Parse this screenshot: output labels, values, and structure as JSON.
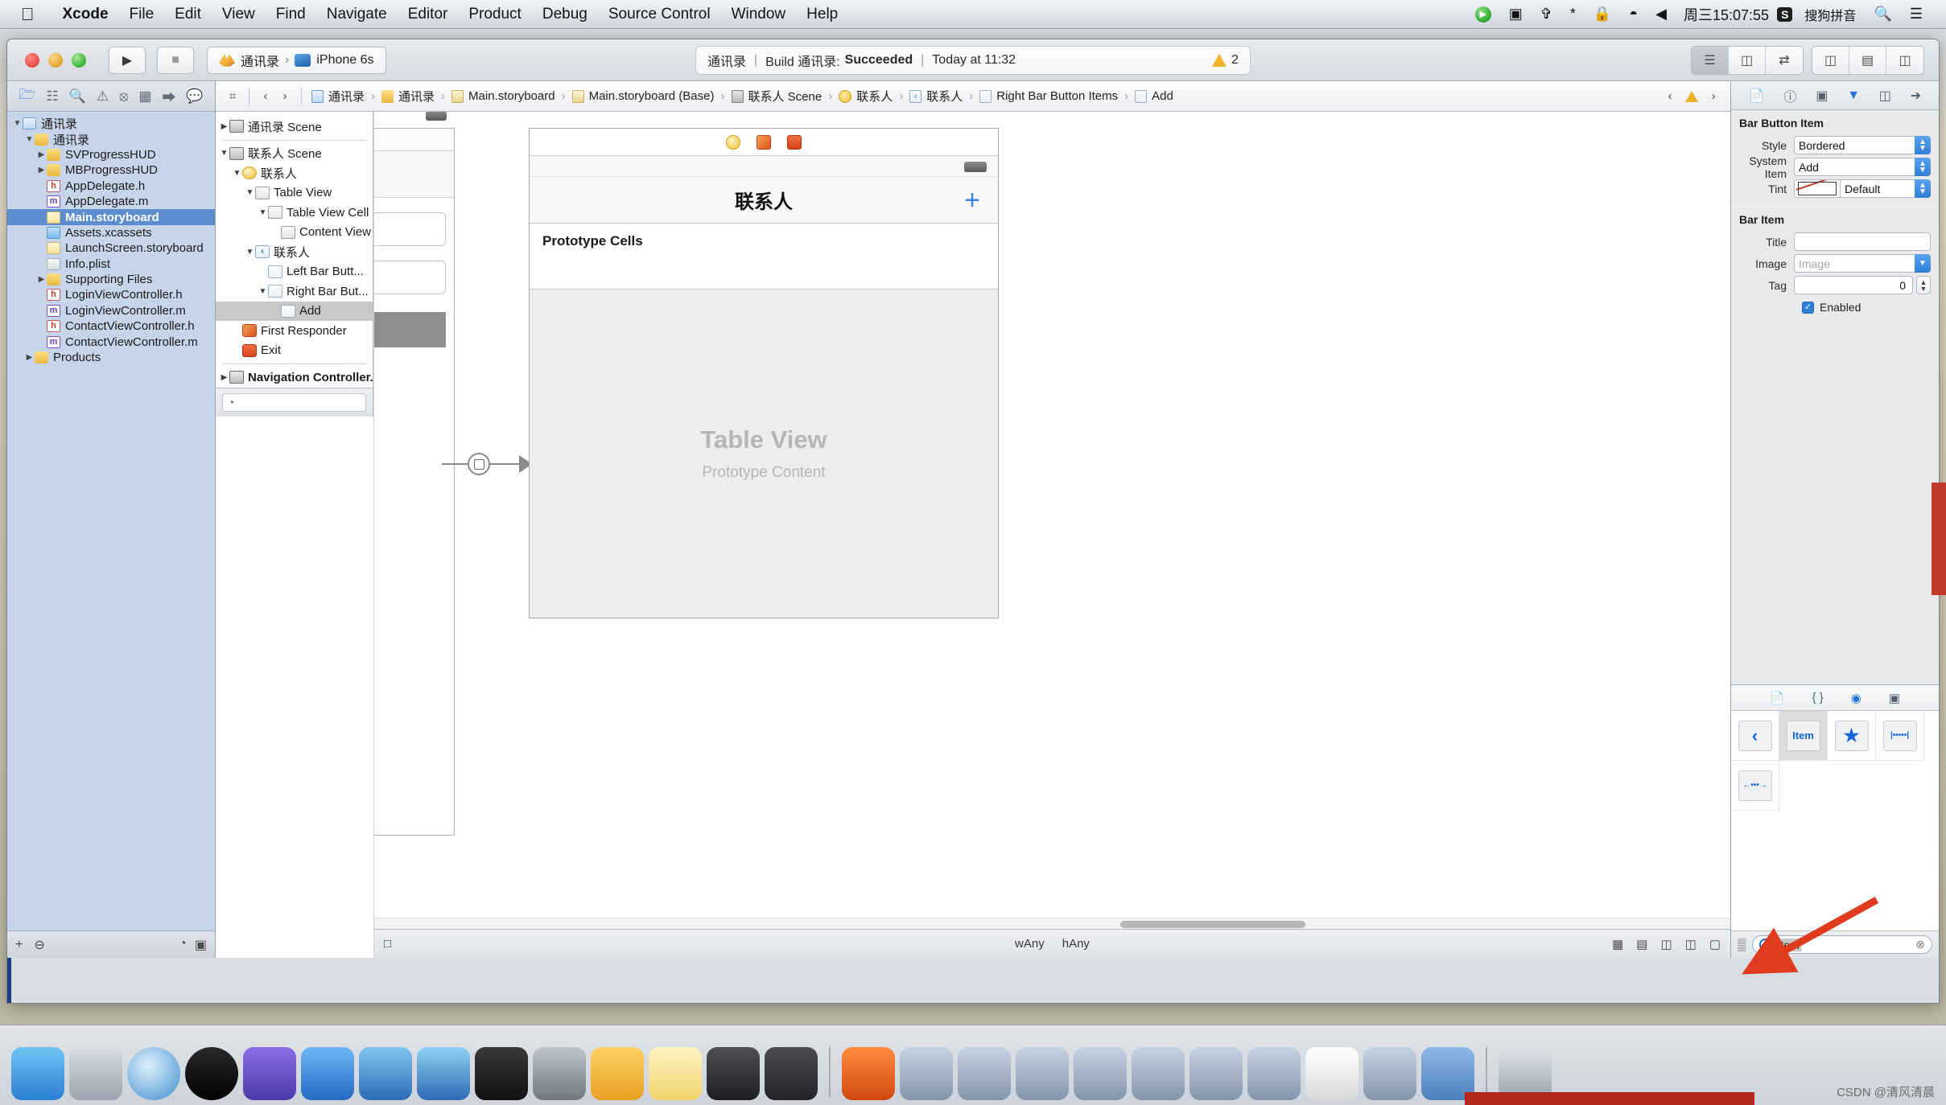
{
  "menubar": {
    "apple_glyph": "",
    "items": [
      "Xcode",
      "File",
      "Edit",
      "View",
      "Find",
      "Navigate",
      "Editor",
      "Product",
      "Debug",
      "Source Control",
      "Window",
      "Help"
    ],
    "clock": "周三15:07:55",
    "input_method": "搜狗拼音",
    "input_badge": "S",
    "status_icons": [
      "play-circle-icon",
      "screen-record-icon",
      "airplay-icon",
      "bluetooth-icon",
      "lock-icon",
      "wifi-icon",
      "volume-icon"
    ]
  },
  "toolbar": {
    "run_glyph": "▶",
    "stop_glyph": "■",
    "scheme_project": "通讯录",
    "scheme_sep": "›",
    "scheme_device": "iPhone 6s",
    "status_project": "通讯录",
    "status_build_label": "Build 通讯录:",
    "status_result": "Succeeded",
    "status_time": "Today at 11:32",
    "warning_count": "2",
    "editor_icons": [
      "standard-editor-icon",
      "assistant-editor-icon",
      "version-editor-icon"
    ],
    "view_icons": [
      "toggle-navigator-icon",
      "toggle-debug-icon",
      "toggle-inspector-icon"
    ]
  },
  "navigator": {
    "tabs": [
      "folder-icon",
      "sourcecontrol-icon",
      "search-icon",
      "warning-icon",
      "breakpoint-icon",
      "report-icon",
      "test-icon",
      "debug-icon"
    ],
    "items": [
      {
        "label": "通讯录",
        "icon": "project-icon",
        "indent": 0,
        "twisty": "▼",
        "selected": false
      },
      {
        "label": "通讯录",
        "icon": "folder-icon",
        "indent": 1,
        "twisty": "▼",
        "selected": false
      },
      {
        "label": "SVProgressHUD",
        "icon": "folder-icon",
        "indent": 2,
        "twisty": "▶",
        "selected": false
      },
      {
        "label": "MBProgressHUD",
        "icon": "folder-icon",
        "indent": 2,
        "twisty": "▶",
        "selected": false
      },
      {
        "label": "AppDelegate.h",
        "icon": "header-file-icon",
        "indent": 2,
        "twisty": "",
        "selected": false
      },
      {
        "label": "AppDelegate.m",
        "icon": "impl-file-icon",
        "indent": 2,
        "twisty": "",
        "selected": false
      },
      {
        "label": "Main.storyboard",
        "icon": "storyboard-icon",
        "indent": 2,
        "twisty": "",
        "selected": true
      },
      {
        "label": "Assets.xcassets",
        "icon": "assets-icon",
        "indent": 2,
        "twisty": "",
        "selected": false
      },
      {
        "label": "LaunchScreen.storyboard",
        "icon": "storyboard-icon",
        "indent": 2,
        "twisty": "",
        "selected": false
      },
      {
        "label": "Info.plist",
        "icon": "plist-icon",
        "indent": 2,
        "twisty": "",
        "selected": false
      },
      {
        "label": "Supporting Files",
        "icon": "folder-icon",
        "indent": 2,
        "twisty": "▶",
        "selected": false
      },
      {
        "label": "LoginViewController.h",
        "icon": "header-file-icon",
        "indent": 2,
        "twisty": "",
        "selected": false
      },
      {
        "label": "LoginViewController.m",
        "icon": "impl-file-icon",
        "indent": 2,
        "twisty": "",
        "selected": false
      },
      {
        "label": "ContactViewController.h",
        "icon": "header-file-icon",
        "indent": 2,
        "twisty": "",
        "selected": false
      },
      {
        "label": "ContactViewController.m",
        "icon": "impl-file-icon",
        "indent": 2,
        "twisty": "",
        "selected": false
      },
      {
        "label": "Products",
        "icon": "folder-icon",
        "indent": 1,
        "twisty": "▶",
        "selected": false
      }
    ],
    "footer": {
      "add_glyph": "+",
      "filter_glyph": "⊖",
      "right_icons": [
        "recent-icon",
        "sourcecontrol-filter-icon"
      ]
    }
  },
  "jumpbar": {
    "grid_glyph": "⌗",
    "back_glyph": "‹",
    "forward_glyph": "›",
    "crumbs": [
      {
        "label": "通讯录",
        "icon": "project-icon"
      },
      {
        "label": "通讯录",
        "icon": "folder-icon"
      },
      {
        "label": "Main.storyboard",
        "icon": "storyboard-icon"
      },
      {
        "label": "Main.storyboard (Base)",
        "icon": "storyboard-icon"
      },
      {
        "label": "联系人 Scene",
        "icon": "scene-icon"
      },
      {
        "label": "联系人",
        "icon": "view-controller-icon"
      },
      {
        "label": "联系人",
        "icon": "navigation-item-icon"
      },
      {
        "label": "Right Bar Button Items",
        "icon": "bar-button-items-icon"
      },
      {
        "label": "Add",
        "icon": "bar-button-item-icon"
      }
    ],
    "right": {
      "prev_glyph": "‹",
      "warning_glyph": "warning-icon",
      "next_glyph": "›"
    }
  },
  "outline": {
    "rows": [
      {
        "label": "通讯录 Scene",
        "icon": "scene-icon",
        "indent": 0,
        "twisty": "▶",
        "selected": false
      },
      {
        "label": "联系人 Scene",
        "icon": "scene-icon",
        "indent": 0,
        "twisty": "▼",
        "selected": false
      },
      {
        "label": "联系人",
        "icon": "view-controller-icon",
        "indent": 1,
        "twisty": "▼",
        "selected": false
      },
      {
        "label": "Table View",
        "icon": "view-icon",
        "indent": 2,
        "twisty": "▼",
        "selected": false
      },
      {
        "label": "Table View Cell",
        "icon": "cell-icon",
        "indent": 3,
        "twisty": "▼",
        "selected": false
      },
      {
        "label": "Content View",
        "icon": "view-icon",
        "indent": 4,
        "twisty": "",
        "selected": false
      },
      {
        "label": "联系人",
        "icon": "navigation-item-icon",
        "indent": 2,
        "twisty": "▼",
        "selected": false
      },
      {
        "label": "Left Bar Butt...",
        "icon": "bar-button-items-icon",
        "indent": 3,
        "twisty": "",
        "selected": false
      },
      {
        "label": "Right Bar But...",
        "icon": "bar-button-items-icon",
        "indent": 3,
        "twisty": "▼",
        "selected": false
      },
      {
        "label": "Add",
        "icon": "bar-button-item-icon",
        "indent": 4,
        "twisty": "",
        "selected": true
      },
      {
        "label": "First Responder",
        "icon": "first-responder-icon",
        "indent": 1,
        "twisty": "",
        "selected": false
      },
      {
        "label": "Exit",
        "icon": "exit-icon",
        "indent": 1,
        "twisty": "",
        "selected": false
      },
      {
        "label": "Navigation Controller...",
        "icon": "scene-icon",
        "indent": 0,
        "twisty": "▶",
        "selected": false
      }
    ],
    "footer_filter_placeholder": ""
  },
  "canvas": {
    "scene_title": "联系人",
    "add_button_glyph": "+",
    "prototype_cells_label": "Prototype Cells",
    "table_view_title": "Table View",
    "table_view_subtitle": "Prototype Content",
    "dock_icons": [
      "view-controller-icon",
      "first-responder-icon",
      "exit-icon"
    ],
    "footer": {
      "size_class_w": "wAny",
      "size_class_h": "hAny",
      "left_glyph": "□",
      "right_icons": [
        "constraints-icon",
        "align-icon",
        "pin-icon",
        "resolve-icon",
        "stack-icon"
      ]
    }
  },
  "inspector": {
    "tabs": [
      "file-inspector-icon",
      "quick-help-icon",
      "identity-inspector-icon",
      "attributes-inspector-icon",
      "size-inspector-icon",
      "connections-inspector-icon"
    ],
    "selected_tab_index": 3,
    "sections": [
      {
        "title": "Bar Button Item",
        "fields": [
          {
            "label": "Style",
            "type": "popup",
            "value": "Bordered"
          },
          {
            "label": "System Item",
            "type": "popup",
            "value": "Add"
          },
          {
            "label": "Tint",
            "type": "color-popup",
            "value": "Default"
          }
        ]
      },
      {
        "title": "Bar Item",
        "fields": [
          {
            "label": "Title",
            "type": "text",
            "value": ""
          },
          {
            "label": "Image",
            "type": "combo",
            "value": "",
            "placeholder": "Image"
          },
          {
            "label": "Tag",
            "type": "stepper",
            "value": "0"
          }
        ],
        "checkbox": {
          "label": "Enabled",
          "checked": true,
          "glyph": "✓"
        }
      }
    ]
  },
  "library": {
    "tabs": [
      "file-template-library-icon",
      "code-snippet-library-icon",
      "object-library-icon",
      "media-library-icon"
    ],
    "selected_tab_index": 2,
    "items": [
      {
        "name": "back-bar-button-item",
        "glyph": "‹",
        "selected": false
      },
      {
        "name": "bar-button-item",
        "glyph": "Item",
        "selected": true
      },
      {
        "name": "star-bar-button-item",
        "glyph": "★",
        "selected": false
      },
      {
        "name": "fixed-space-bar-button-item",
        "glyph": "|•••••|",
        "selected": false
      },
      {
        "name": "flexible-space-bar-button-item",
        "glyph": "←•••→",
        "selected": false
      }
    ],
    "search_value": "Item",
    "grid_glyph": "▒",
    "clear_glyph": "⊗"
  },
  "watermark": "CSDN @清风清晨"
}
